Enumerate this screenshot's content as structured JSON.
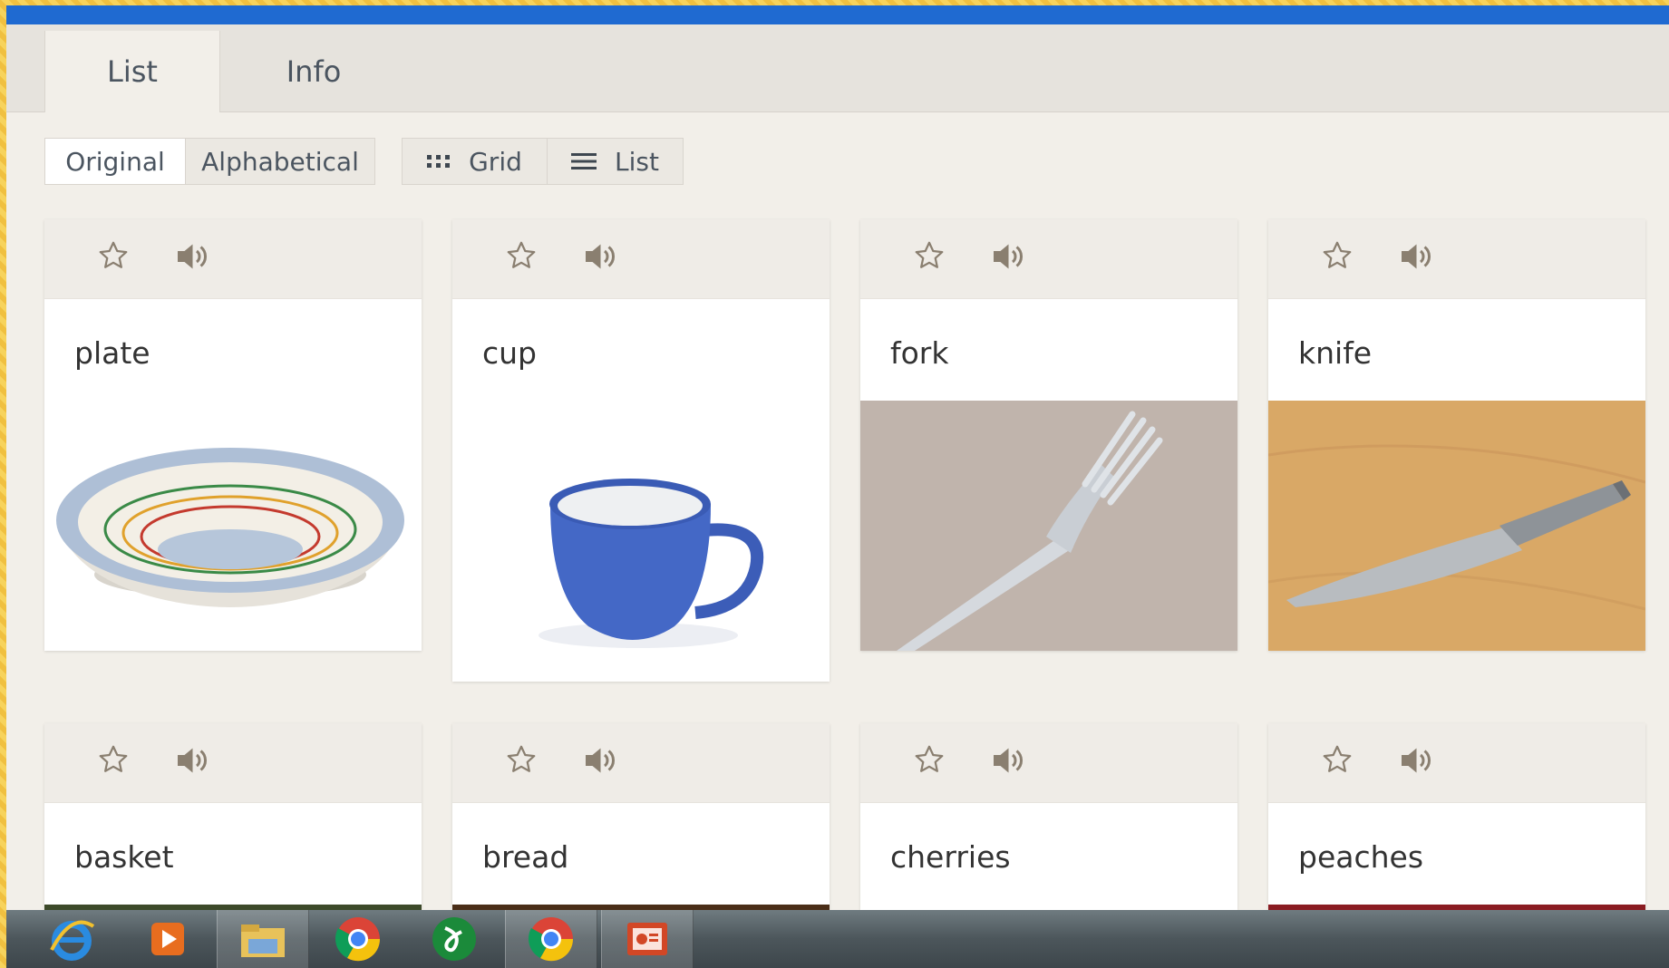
{
  "tabs": {
    "list": "List",
    "info": "Info"
  },
  "sort": {
    "original": "Original",
    "alphabetical": "Alphabetical"
  },
  "view": {
    "grid": "Grid",
    "list": "List"
  },
  "cards": [
    {
      "word": "plate"
    },
    {
      "word": "cup"
    },
    {
      "word": "fork"
    },
    {
      "word": "knife"
    },
    {
      "word": "basket"
    },
    {
      "word": "bread"
    },
    {
      "word": "cherries"
    },
    {
      "word": "peaches"
    }
  ],
  "icons": {
    "star": "star-icon",
    "sound": "speaker-icon",
    "grid": "grid-icon",
    "list": "list-icon"
  },
  "colors": {
    "accent_bar": "#1f6ad1",
    "background": "#f2efe9",
    "icon": "#8a7f70",
    "text": "#4b5560"
  },
  "taskbar": {
    "apps": [
      "internet-explorer-icon",
      "media-player-icon",
      "file-explorer-icon",
      "chrome-icon",
      "app-green-icon",
      "chrome-icon",
      "powerpoint-icon"
    ]
  }
}
